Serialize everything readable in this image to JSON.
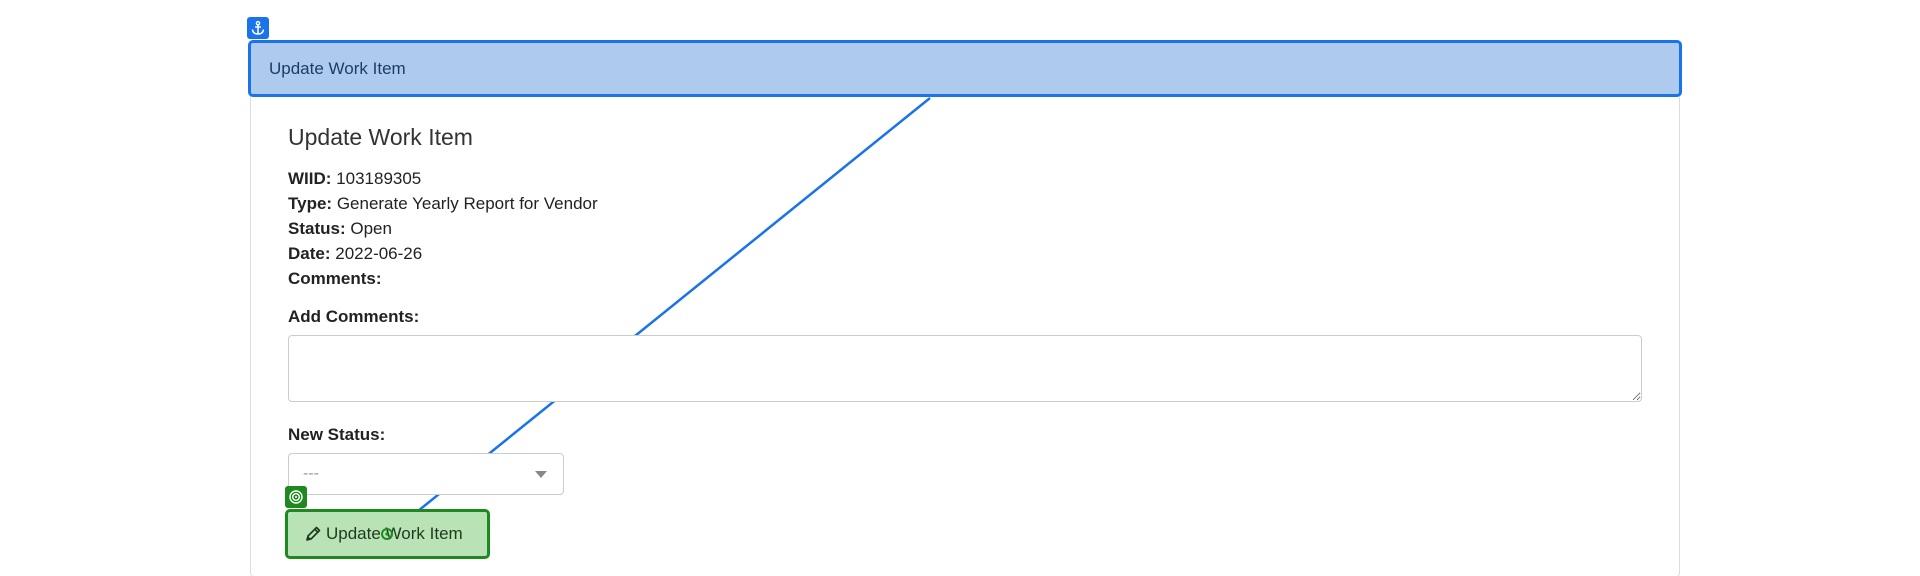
{
  "header": {
    "title": "Update Work Item"
  },
  "form": {
    "title": "Update Work Item",
    "details": [
      {
        "label": "WIID:",
        "value": "103189305"
      },
      {
        "label": "Type:",
        "value": "Generate Yearly Report for Vendor"
      },
      {
        "label": "Status:",
        "value": "Open"
      },
      {
        "label": "Date:",
        "value": "2022-06-26"
      },
      {
        "label": "Comments:",
        "value": ""
      }
    ],
    "add_comments_label": "Add Comments:",
    "add_comments_value": "",
    "new_status_label": "New Status:",
    "new_status_selected": "---",
    "submit_label": "Update Work Item"
  },
  "icons": {
    "anchor": "anchor-icon",
    "target": "target-icon",
    "pencil": "pencil-icon",
    "dropdown": "chevron-down-icon"
  },
  "colors": {
    "anchor_accent": "#1a73e8",
    "header_fill": "#aecbef",
    "target_accent": "#1e8a1e",
    "button_fill": "#b9e3b6"
  }
}
